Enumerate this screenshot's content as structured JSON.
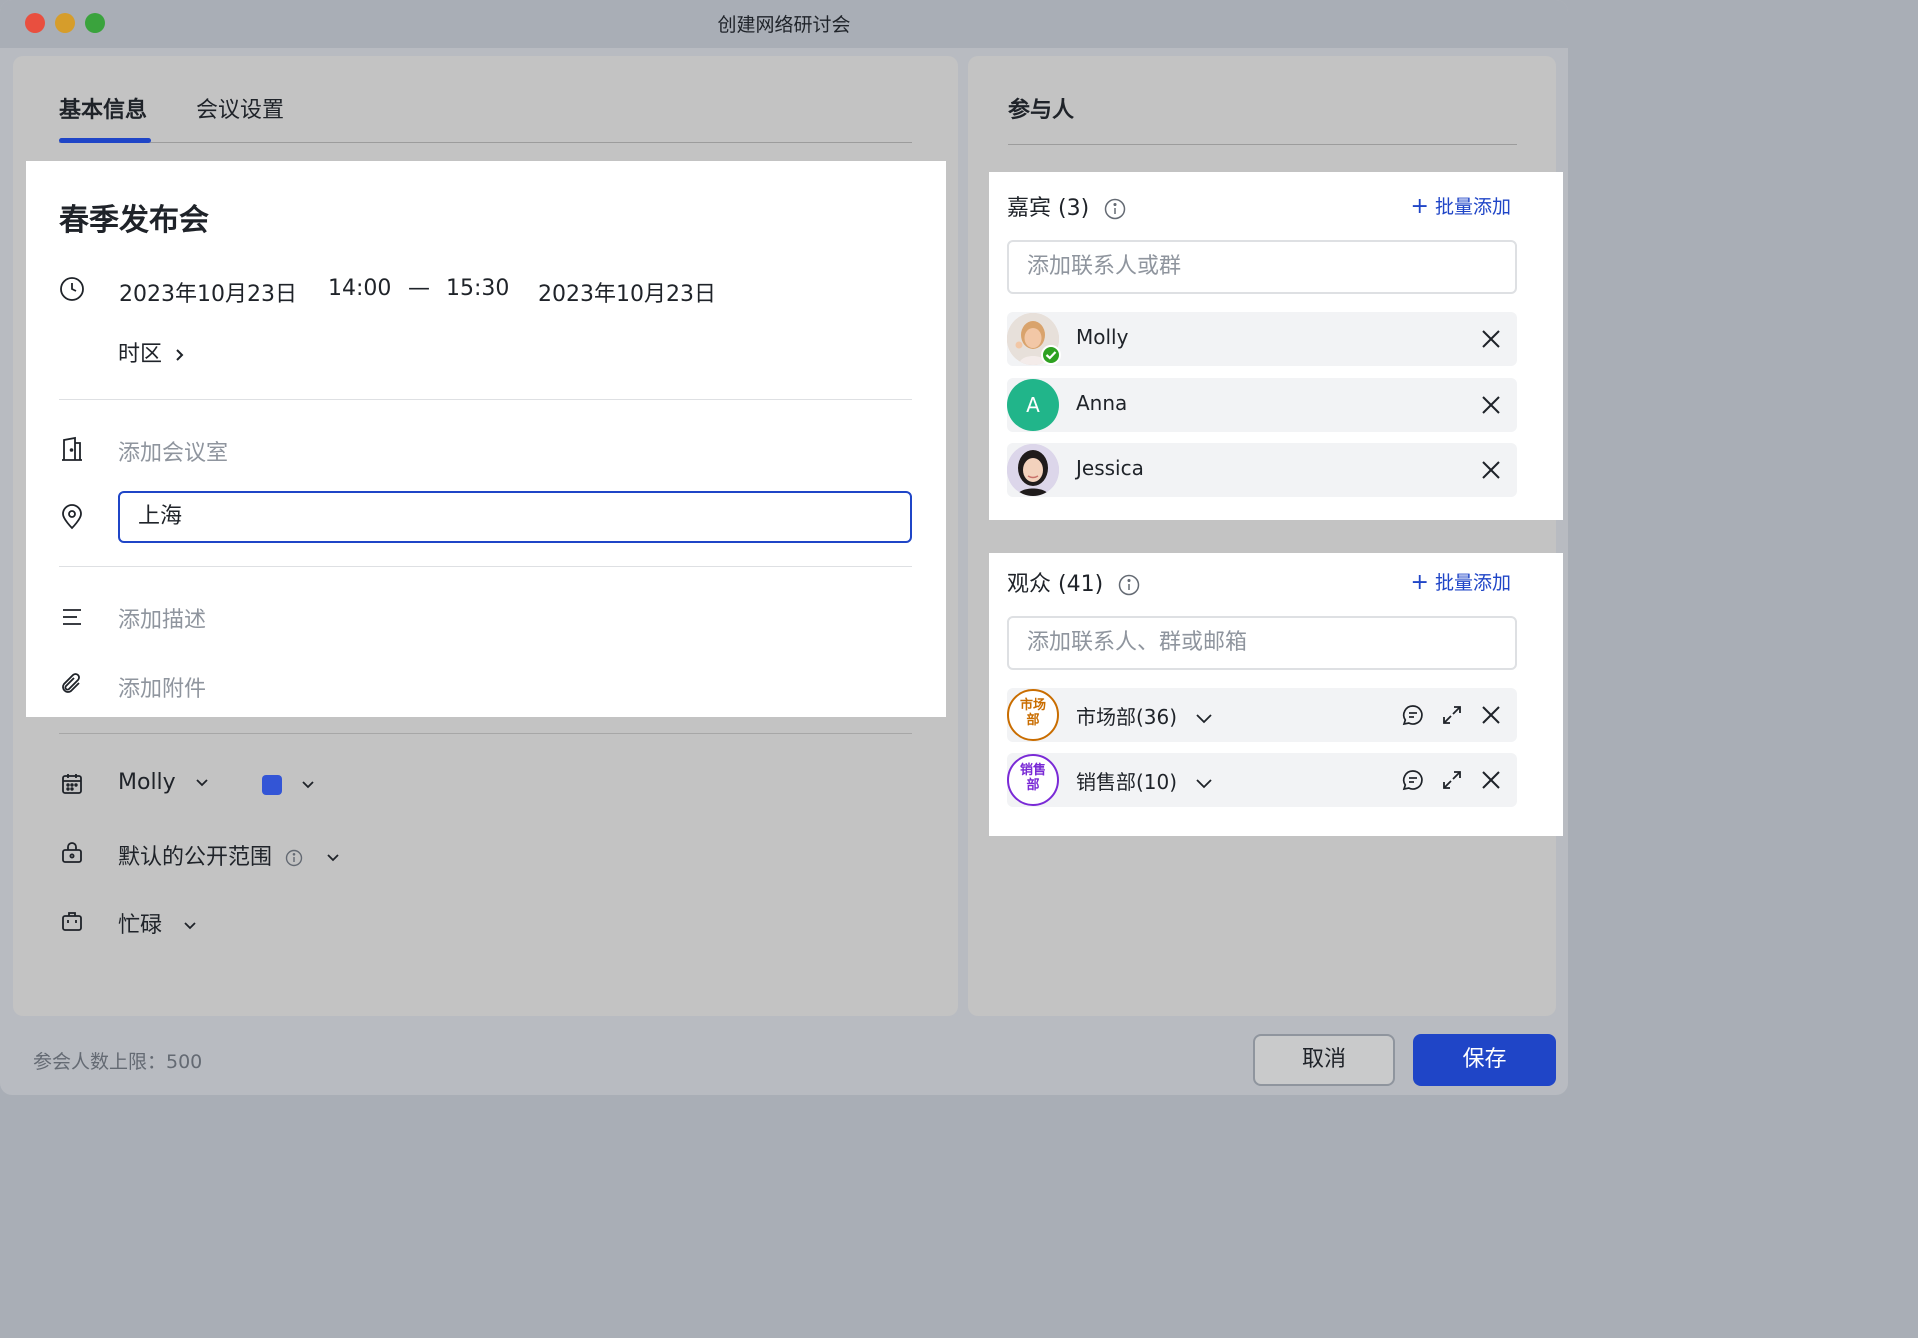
{
  "window": {
    "title": "创建网络研讨会"
  },
  "tabs": [
    {
      "label": "基本信息",
      "active": true
    },
    {
      "label": "会议设置",
      "active": false
    }
  ],
  "basic": {
    "meeting_title": "春季发布会",
    "start_date": "2023年10月23日",
    "start_time": "14:00",
    "dash": "—",
    "end_time": "15:30",
    "end_date": "2023年10月23日",
    "timezone_label": "时区",
    "room_placeholder": "添加会议室",
    "location_value": "上海",
    "description_placeholder": "添加描述",
    "attachment_placeholder": "添加附件"
  },
  "settings": {
    "calendar_owner": "Molly",
    "calendar_color": "#3355d6",
    "visibility_label": "默认的公开范围",
    "busy_label": "忙碌"
  },
  "participants": {
    "title": "参与人",
    "guests": {
      "title": "嘉宾 (3)",
      "batch_add": "批量添加",
      "input_placeholder": "添加联系人或群",
      "items": [
        {
          "name": "Molly"
        },
        {
          "name": "Anna",
          "initial": "A"
        },
        {
          "name": "Jessica"
        }
      ]
    },
    "audience": {
      "title": "观众 (41)",
      "batch_add": "批量添加",
      "input_placeholder": "添加联系人、群或邮箱",
      "items": [
        {
          "name": "市场部(36)",
          "badge_line1": "市场",
          "badge_line2": "部",
          "color": "#c96d00"
        },
        {
          "name": "销售部(10)",
          "badge_line1": "销售",
          "badge_line2": "部",
          "color": "#7a2ad6"
        }
      ]
    }
  },
  "footer": {
    "limit_text": "参会人数上限：500",
    "cancel_label": "取消",
    "save_label": "保存"
  },
  "colors": {
    "accent": "#1f45c7"
  }
}
